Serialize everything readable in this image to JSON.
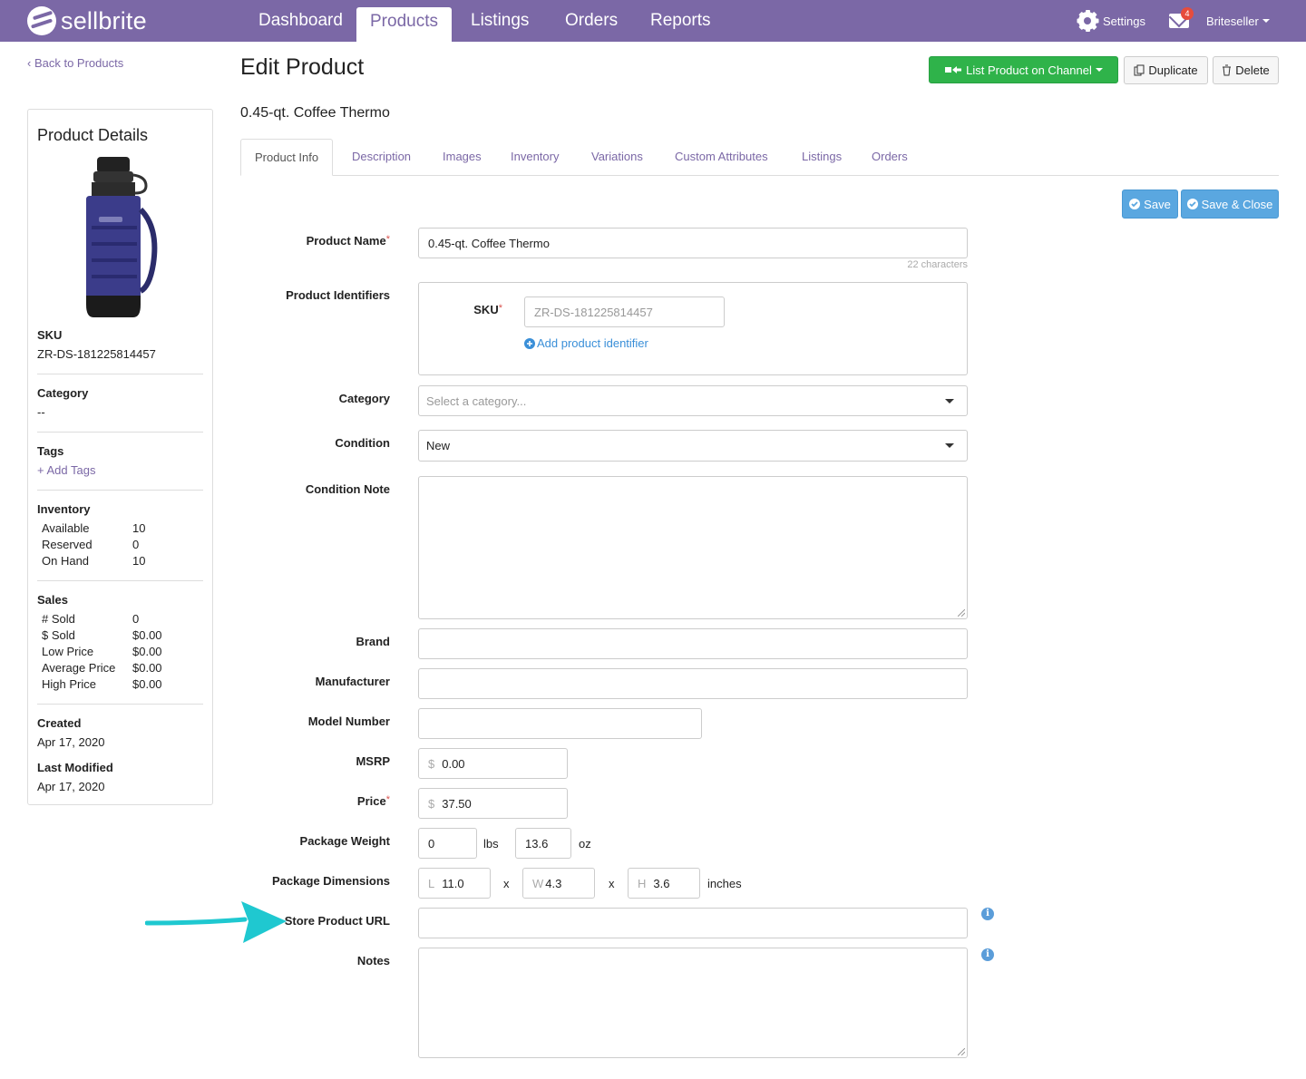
{
  "brand": {
    "name": "sellbrite",
    "color": "#7b68a6"
  },
  "nav": {
    "items": [
      "Dashboard",
      "Products",
      "Listings",
      "Orders",
      "Reports"
    ],
    "active": "Products",
    "settings_label": "Settings",
    "mail_count": "4",
    "user_label": "Briteseller"
  },
  "back_link": "Back to Products",
  "page_title": "Edit Product",
  "product_name": "0.45-qt. Coffee Thermo",
  "actions": {
    "list_channel": "List Product on Channel",
    "duplicate": "Duplicate",
    "delete": "Delete",
    "save": "Save",
    "save_close": "Save & Close"
  },
  "details": {
    "title": "Product Details",
    "sku_label": "SKU",
    "sku": "ZR-DS-181225814457",
    "category_label": "Category",
    "category": "--",
    "tags_label": "Tags",
    "add_tags": "+ Add Tags",
    "inventory_label": "Inventory",
    "inventory": [
      {
        "k": "Available",
        "v": "10"
      },
      {
        "k": "Reserved",
        "v": "0"
      },
      {
        "k": "On Hand",
        "v": "10"
      }
    ],
    "sales_label": "Sales",
    "sales": [
      {
        "k": "# Sold",
        "v": "0"
      },
      {
        "k": "$ Sold",
        "v": "$0.00"
      },
      {
        "k": "Low Price",
        "v": "$0.00"
      },
      {
        "k": "Average Price",
        "v": "$0.00"
      },
      {
        "k": "High Price",
        "v": "$0.00"
      }
    ],
    "created_label": "Created",
    "created": "Apr 17, 2020",
    "modified_label": "Last Modified",
    "modified": "Apr 17, 2020"
  },
  "tabs": [
    "Product Info",
    "Description",
    "Images",
    "Inventory",
    "Variations",
    "Custom Attributes",
    "Listings",
    "Orders"
  ],
  "active_tab": "Product Info",
  "form": {
    "product_name_label": "Product Name",
    "product_name_value": "0.45-qt. Coffee Thermo",
    "char_count": "22 characters",
    "identifiers_label": "Product Identifiers",
    "sku_label": "SKU",
    "sku_value": "ZR-DS-181225814457",
    "add_identifier": "Add product identifier",
    "category_label": "Category",
    "category_placeholder": "Select a category...",
    "condition_label": "Condition",
    "condition_value": "New",
    "condition_note_label": "Condition Note",
    "brand_label": "Brand",
    "manufacturer_label": "Manufacturer",
    "model_label": "Model Number",
    "msrp_label": "MSRP",
    "msrp_prefix": "$",
    "msrp_value": "0.00",
    "price_label": "Price",
    "price_prefix": "$",
    "price_value": "37.50",
    "weight_label": "Package Weight",
    "weight_lbs": "0",
    "weight_lbs_unit": "lbs",
    "weight_oz": "13.6",
    "weight_oz_unit": "oz",
    "dims_label": "Package Dimensions",
    "dim_l_prefix": "L",
    "dim_l": "11.0",
    "dim_w_prefix": "W",
    "dim_w": "4.3",
    "dim_h_prefix": "H",
    "dim_h": "3.6",
    "dim_x": "x",
    "dim_unit": "inches",
    "store_url_label": "Store Product URL",
    "notes_label": "Notes",
    "required_mark": "*",
    "info_glyph": "i"
  },
  "colors": {
    "arrow": "#1fc8d0",
    "save": "#5aa7e0",
    "channel": "#2fb34a"
  }
}
